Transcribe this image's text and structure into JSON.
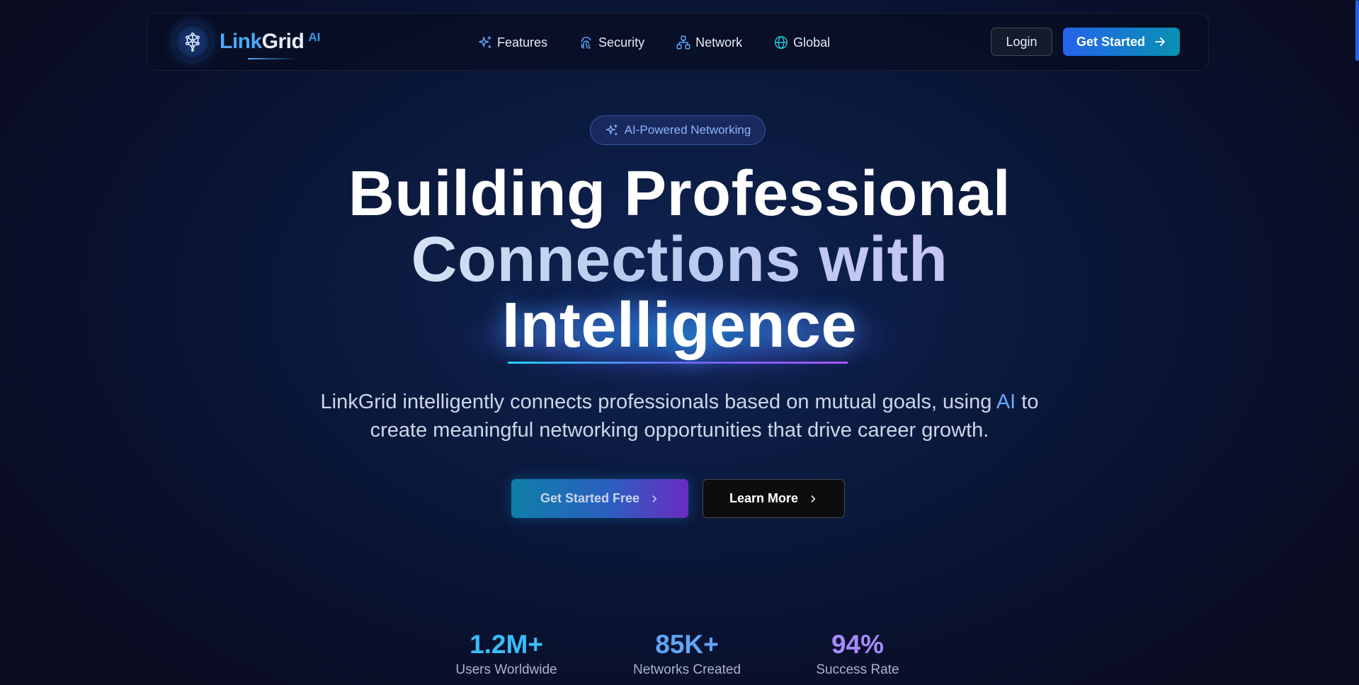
{
  "brand": {
    "name_part1": "Link",
    "name_part2": "Grid",
    "suffix": "AI"
  },
  "nav": {
    "items": [
      {
        "label": "Features",
        "icon": "sparkle-icon"
      },
      {
        "label": "Security",
        "icon": "fingerprint-icon"
      },
      {
        "label": "Network",
        "icon": "network-icon"
      },
      {
        "label": "Global",
        "icon": "globe-icon"
      }
    ],
    "login_label": "Login",
    "get_started_label": "Get Started"
  },
  "hero": {
    "badge": "AI-Powered Networking",
    "headline_line1": "Building Professional",
    "headline_line2": "Connections with",
    "headline_line3": "Intelligence",
    "subtitle_part1": "LinkGrid intelligently connects professionals based on mutual goals, using ",
    "subtitle_ai": "AI",
    "subtitle_part2": " to",
    "subtitle_line2": "create meaningful networking opportunities that drive career growth.",
    "cta_primary": "Get Started Free",
    "cta_secondary": "Learn More"
  },
  "stats": [
    {
      "value": "1.2M+",
      "label": "Users Worldwide",
      "color": "#38bdf8"
    },
    {
      "value": "85K+",
      "label": "Networks Created",
      "color": "#60a5fa"
    },
    {
      "value": "94%",
      "label": "Success Rate",
      "color": "#a78bfa"
    }
  ],
  "colors": {
    "accent": "#2563eb",
    "cyan": "#0891b2",
    "purple": "#a855f7"
  }
}
